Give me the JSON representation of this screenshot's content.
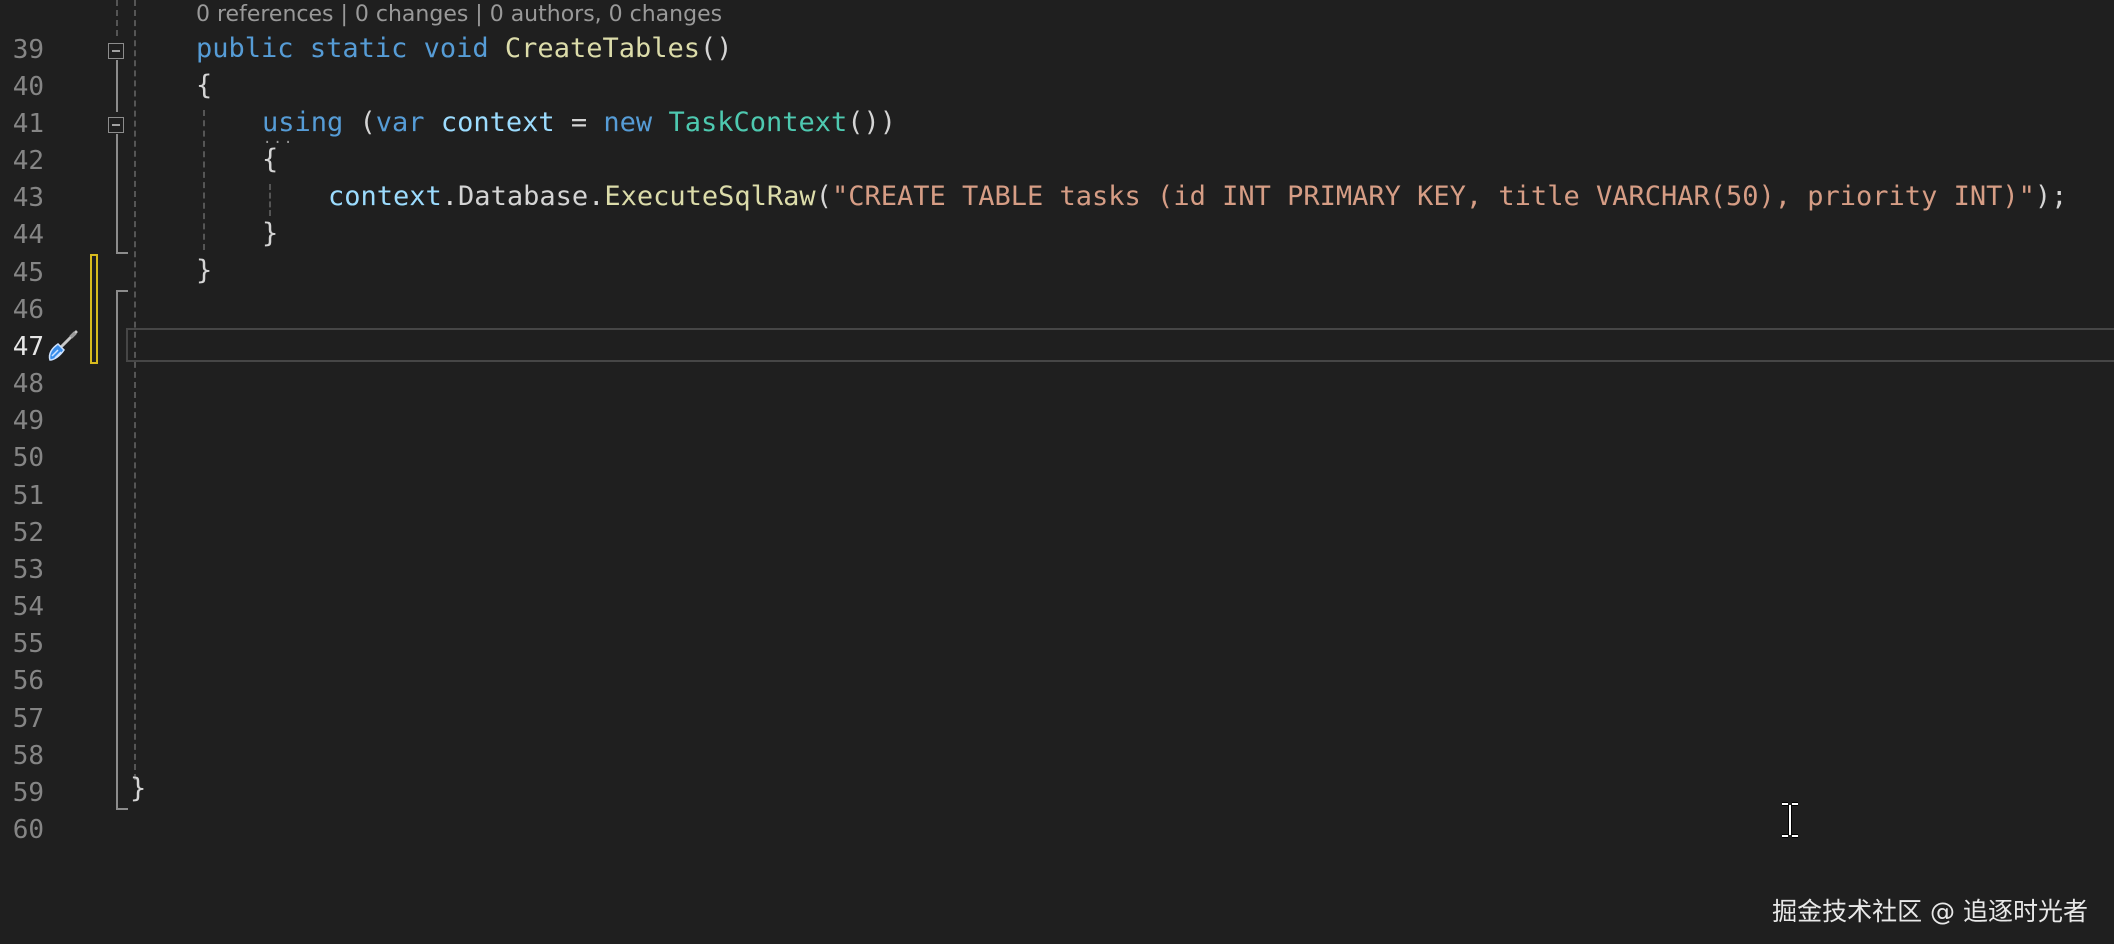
{
  "codelens": "0 references | 0 changes | 0 authors, 0 changes",
  "line_numbers": [
    "39",
    "40",
    "41",
    "42",
    "43",
    "44",
    "45",
    "46",
    "47",
    "48",
    "49",
    "50",
    "51",
    "52",
    "53",
    "54",
    "55",
    "56",
    "57",
    "58",
    "59",
    "60"
  ],
  "active_line": "47",
  "code": {
    "l39": {
      "kw1": "public",
      "kw2": "static",
      "kw3": "void",
      "fn": "CreateTables",
      "rest": "()"
    },
    "l40": {
      "text": "{"
    },
    "l41": {
      "kw1": "using",
      "p1": " (",
      "kw2": "var",
      "v1": "context",
      "p2": " = ",
      "kw3": "new",
      "ty": "TaskContext",
      "p3": "())"
    },
    "l42": {
      "text": "{"
    },
    "l43": {
      "v1": "context",
      "p1": ".Database.",
      "fn": "ExecuteSqlRaw",
      "p2": "(",
      "str": "\"CREATE TABLE tasks (id INT PRIMARY KEY, title VARCHAR(50), priority INT)\"",
      "p3": ");"
    },
    "l44": {
      "text": "}"
    },
    "l45": {
      "text": "}"
    },
    "l59": {
      "text": "}"
    }
  },
  "squiggle": "···",
  "icons": {
    "fold": "collapse-icon",
    "brush": "code-cleanup-brush-icon",
    "cursor": "text-cursor-icon"
  },
  "colors": {
    "background": "#1f1f1f",
    "keyword": "#569cd6",
    "type": "#4ec9b0",
    "function": "#dcdcaa",
    "variable": "#9cdcfe",
    "string": "#d69d85",
    "change_bar": "#d7ba1e"
  },
  "watermark": "掘金技术社区 @ 追逐时光者"
}
